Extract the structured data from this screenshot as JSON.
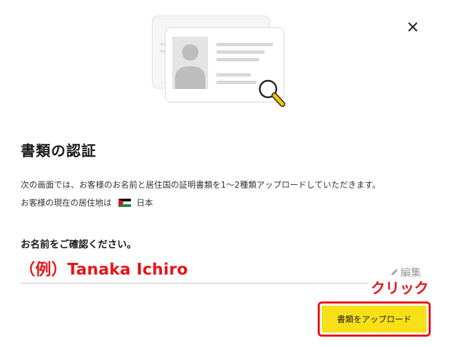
{
  "dialog": {
    "close_symbol": "×",
    "title": "書類の認証",
    "description_line1": "次の画面では、お客様のお名前と居住国の証明書類を1～2種類アップロードしていただきます。",
    "residence_prefix": "お客様の現在の居住地は",
    "residence_country": "日本",
    "name_section_label": "お名前をご確認ください。",
    "edit_label": "編集",
    "upload_button_label": "書類をアップロード"
  },
  "annotations": {
    "example_name": "（例）Tanaka Ichiro",
    "click_label": "クリック"
  },
  "colors": {
    "annotation_red": "#e8141a",
    "button_yellow": "#f7e017"
  },
  "icons": [
    "close-icon",
    "id-card-illustration",
    "magnifier-icon",
    "flag-icon",
    "pencil-icon"
  ]
}
